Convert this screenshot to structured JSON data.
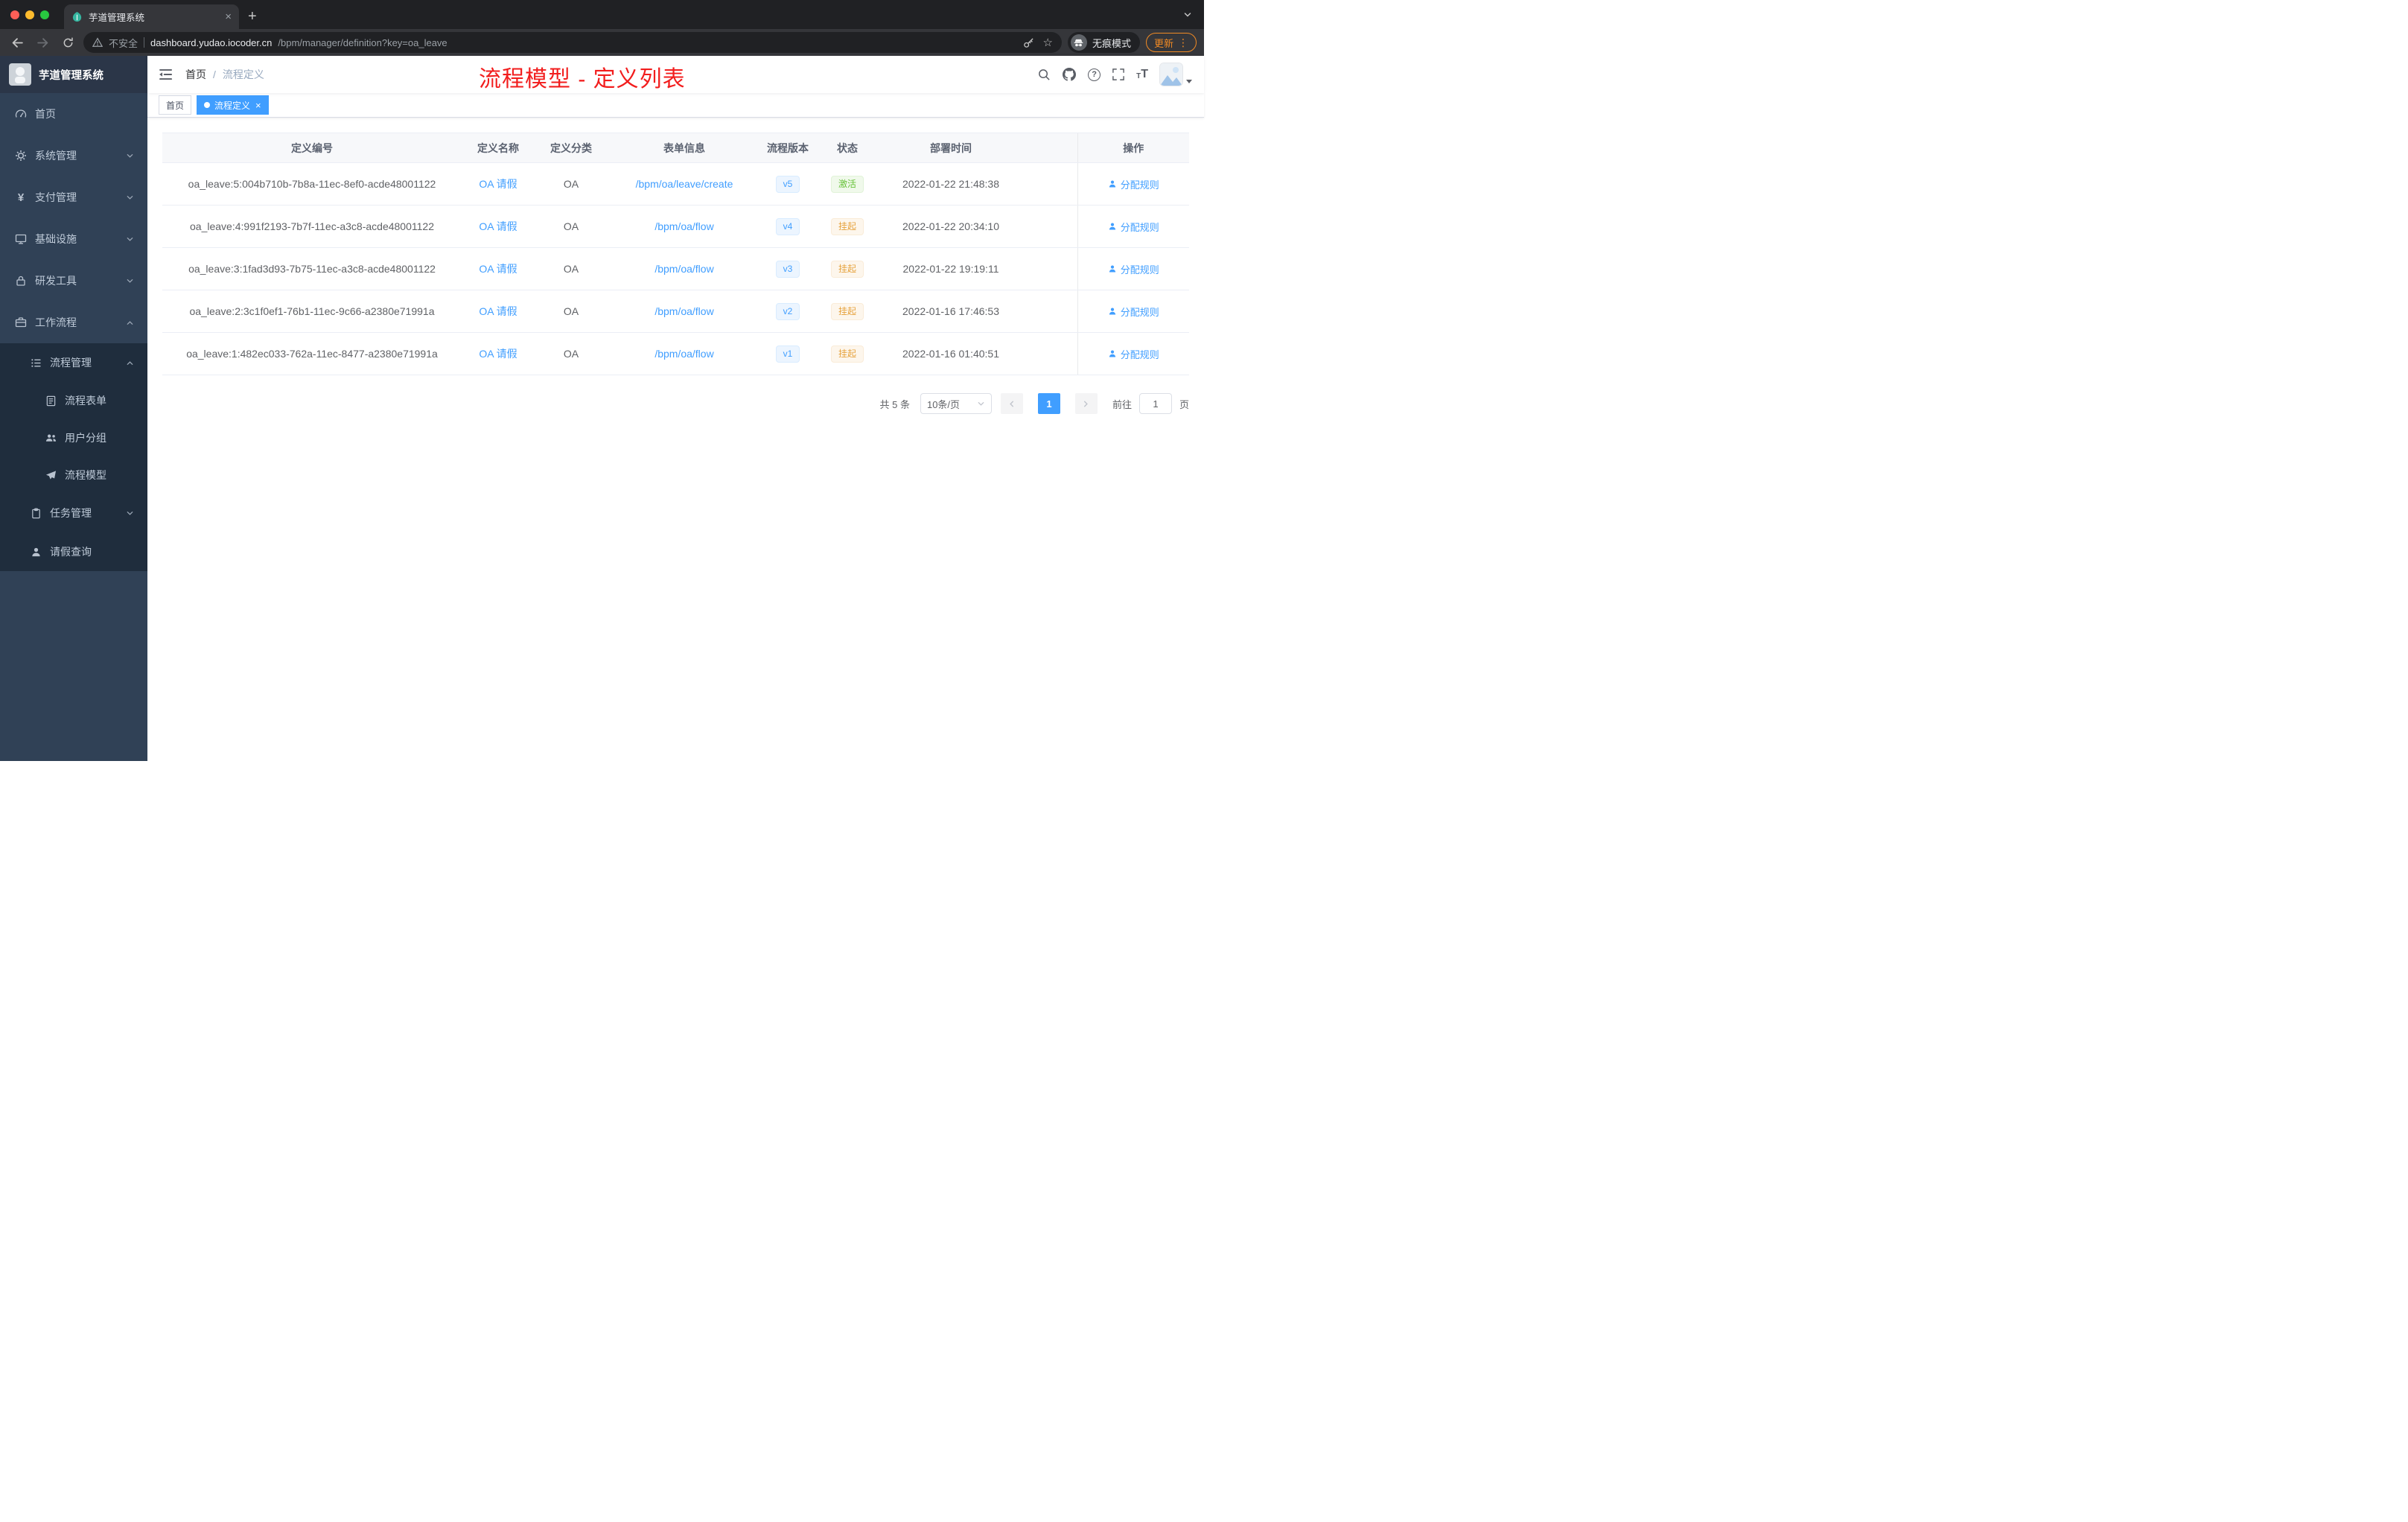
{
  "colors": {
    "accent": "#409eff",
    "success": "#67c23a",
    "warning": "#e6a23c",
    "annotation_red": "#f21d1d",
    "update_orange": "#f08a24",
    "sidebar_bg": "#304156",
    "submenu_bg": "#1f2d3d"
  },
  "icons": {
    "close": "×",
    "plus": "+",
    "star": "☆",
    "dots": "⋮",
    "yen": "¥",
    "question": "?",
    "font_big": "T",
    "font_small": "T"
  },
  "browser": {
    "tab_title": "芋道管理系统",
    "security_label": "不安全",
    "url_host": "dashboard.yudao.iocoder.cn",
    "url_path": "/bpm/manager/definition?key=oa_leave",
    "incognito_label": "无痕模式",
    "update_label": "更新"
  },
  "sidebar": {
    "logo_title": "芋道管理系统",
    "items": [
      {
        "label": "首页"
      },
      {
        "label": "系统管理"
      },
      {
        "label": "支付管理"
      },
      {
        "label": "基础设施"
      },
      {
        "label": "研发工具"
      },
      {
        "label": "工作流程"
      },
      {
        "label": "流程管理"
      },
      {
        "label": "流程表单"
      },
      {
        "label": "用户分组"
      },
      {
        "label": "流程模型"
      },
      {
        "label": "任务管理"
      },
      {
        "label": "请假查询"
      }
    ]
  },
  "header": {
    "breadcrumb_home": "首页",
    "breadcrumb_sep": "/",
    "breadcrumb_current": "流程定义",
    "annotation": "流程模型 - 定义列表"
  },
  "tags": {
    "home": "首页",
    "active": "流程定义"
  },
  "table": {
    "columns": [
      "定义编号",
      "定义名称",
      "定义分类",
      "表单信息",
      "流程版本",
      "状态",
      "部署时间",
      "操作"
    ],
    "rows": [
      {
        "id": "oa_leave:5:004b710b-7b8a-11ec-8ef0-acde48001122",
        "name": "OA 请假",
        "category": "OA",
        "form": "/bpm/oa/leave/create",
        "version": "v5",
        "status": "激活",
        "status_type": "success",
        "deploy_time": "2022-01-22 21:48:38",
        "action": "分配规则"
      },
      {
        "id": "oa_leave:4:991f2193-7b7f-11ec-a3c8-acde48001122",
        "name": "OA 请假",
        "category": "OA",
        "form": "/bpm/oa/flow",
        "version": "v4",
        "status": "挂起",
        "status_type": "warning",
        "deploy_time": "2022-01-22 20:34:10",
        "action": "分配规则"
      },
      {
        "id": "oa_leave:3:1fad3d93-7b75-11ec-a3c8-acde48001122",
        "name": "OA 请假",
        "category": "OA",
        "form": "/bpm/oa/flow",
        "version": "v3",
        "status": "挂起",
        "status_type": "warning",
        "deploy_time": "2022-01-22 19:19:11",
        "action": "分配规则"
      },
      {
        "id": "oa_leave:2:3c1f0ef1-76b1-11ec-9c66-a2380e71991a",
        "name": "OA 请假",
        "category": "OA",
        "form": "/bpm/oa/flow",
        "version": "v2",
        "status": "挂起",
        "status_type": "warning",
        "deploy_time": "2022-01-16 17:46:53",
        "action": "分配规则"
      },
      {
        "id": "oa_leave:1:482ec033-762a-11ec-8477-a2380e71991a",
        "name": "OA 请假",
        "category": "OA",
        "form": "/bpm/oa/flow",
        "version": "v1",
        "status": "挂起",
        "status_type": "warning",
        "deploy_time": "2022-01-16 01:40:51",
        "action": "分配规则"
      }
    ]
  },
  "pagination": {
    "total": "共 5 条",
    "page_size": "10条/页",
    "current_page": "1",
    "goto_label": "前往",
    "goto_value": "1",
    "unit_label": "页"
  }
}
